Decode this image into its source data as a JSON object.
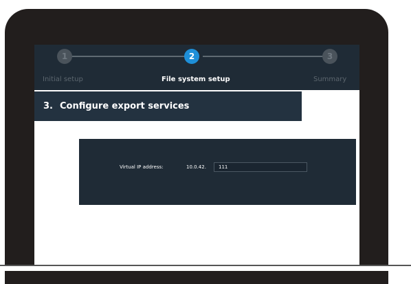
{
  "wizard": {
    "steps": [
      {
        "number": "1",
        "label": "Initial setup",
        "state": "inactive"
      },
      {
        "number": "2",
        "label": "File system setup",
        "state": "active"
      },
      {
        "number": "3",
        "label": "Summary",
        "state": "inactive"
      }
    ]
  },
  "section": {
    "number": "3.",
    "title": "Configure export services"
  },
  "form": {
    "vip_label": "Virtual IP address:",
    "vip_prefix": "10.0.42.",
    "vip_value": "111"
  },
  "colors": {
    "bezel": "#221e1d",
    "panel": "#1f2b36",
    "header": "#233240",
    "active_step": "#1e8fd8",
    "inactive_step": "#4a535b"
  }
}
